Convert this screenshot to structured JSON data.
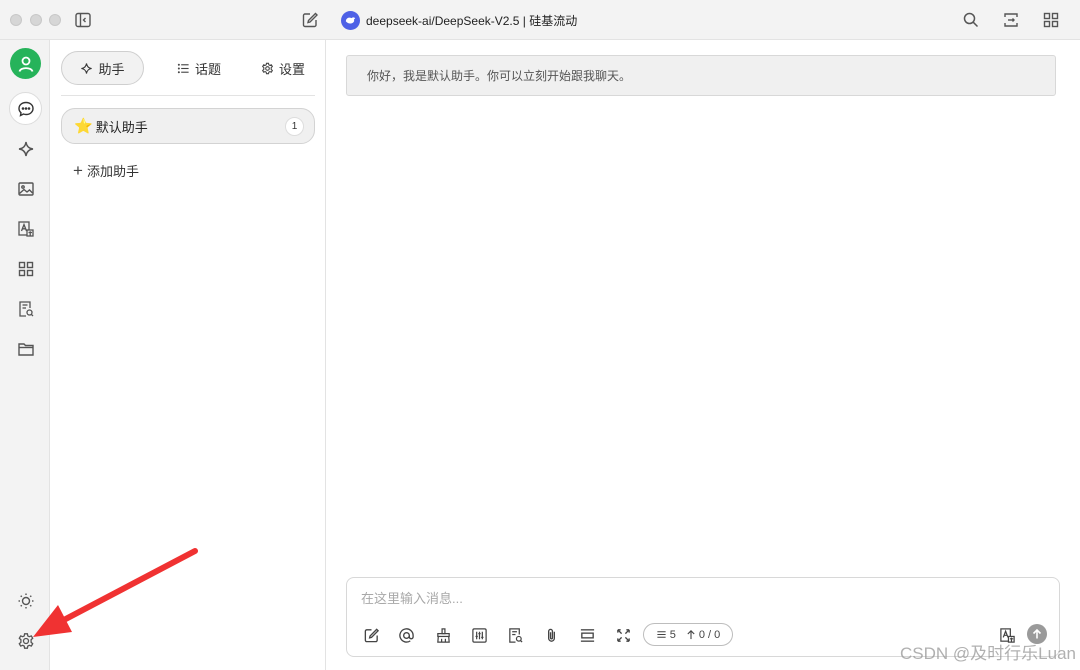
{
  "app": {
    "model_name": "deepseek-ai/DeepSeek-V2.5 | 硅基流动"
  },
  "titlebar": {
    "icons": [
      "sidebar-toggle-icon",
      "edit-icon",
      "search-icon",
      "expand-icon",
      "grid-icon"
    ]
  },
  "rail": {
    "items": [
      "avatar",
      "chat-icon",
      "sparkle-icon",
      "image-icon",
      "translate-icon",
      "apps-icon",
      "knowledge-icon",
      "folder-icon"
    ],
    "bottom": [
      "sun-icon",
      "gear-icon"
    ]
  },
  "sidebar": {
    "tabs": [
      {
        "label": "助手",
        "icon": "sparkle-icon",
        "active": true
      },
      {
        "label": "话题",
        "icon": "list-icon",
        "active": false
      },
      {
        "label": "设置",
        "icon": "gear-icon",
        "active": false
      }
    ],
    "assistants": [
      {
        "emoji": "⭐️",
        "name": "默认助手",
        "count": "1"
      }
    ],
    "add_label": "添加助手"
  },
  "chat": {
    "welcome": "你好，我是默认助手。你可以立刻开始跟我聊天。"
  },
  "composer": {
    "placeholder": "在这里输入消息...",
    "context_count": "5",
    "token_count": "0 / 0",
    "tools": [
      "new-topic-icon",
      "mention-icon",
      "clear-icon",
      "settings-icon",
      "knowledge-icon",
      "attachment-icon",
      "divider-icon",
      "fullscreen-icon"
    ],
    "colors": {
      "send": "#9a9a9a"
    }
  },
  "watermark": "CSDN @及时行乐Luan",
  "colors": {
    "avatar": "#26b35a",
    "model_logo": "#4e61e6",
    "arrow": "#f03232"
  }
}
